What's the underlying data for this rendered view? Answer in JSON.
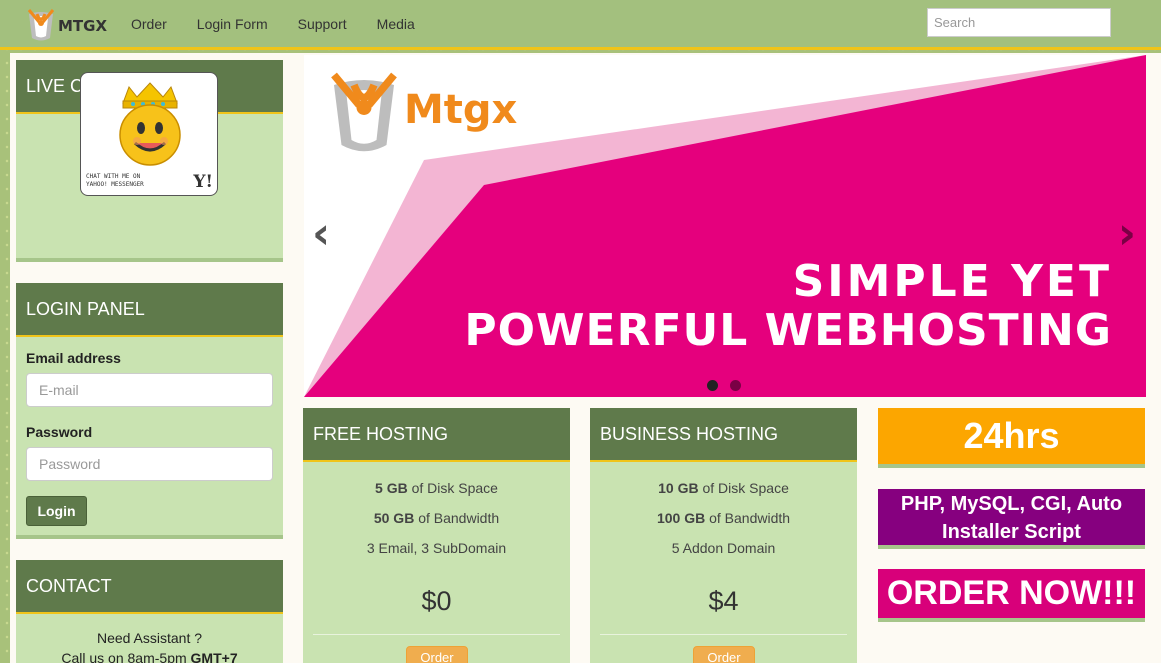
{
  "nav": {
    "brand": "MTGX",
    "links": [
      "Order",
      "Login Form",
      "Support",
      "Media"
    ],
    "search_placeholder": "Search"
  },
  "live_chat": {
    "title": "LIVE CHAT",
    "caption_line1": "CHAT WITH ME ON",
    "caption_line2": "YAHOO! MESSENGER",
    "yahoo_mark": "Y!"
  },
  "login_panel": {
    "title": "LOGIN PANEL",
    "email_label": "Email address",
    "email_placeholder": "E-mail",
    "password_label": "Password",
    "password_placeholder": "Password",
    "login_button": "Login"
  },
  "contact": {
    "title": "CONTACT",
    "line1": "Need Assistant ?",
    "line2_prefix": "Call us on 8am-5pm ",
    "line2_bold": "GMT+7"
  },
  "slider": {
    "logo_text": "Mtgx",
    "headline1": "SIMPLE YET",
    "headline2": "POWERFUL WEBHOSTING",
    "prev_arrow": "‹",
    "next_arrow": "›",
    "active_slide": 1,
    "slide_count": 2,
    "colors": {
      "magenta": "#e5007d",
      "pink": "#f3b5d3"
    }
  },
  "plans": [
    {
      "title": "FREE HOSTING",
      "features": [
        {
          "bold": "5 GB",
          "text": " of Disk Space"
        },
        {
          "bold": "50 GB",
          "text": " of Bandwidth"
        },
        {
          "bold": "",
          "text": "3 Email, 3 SubDomain"
        }
      ],
      "price": "$0",
      "order_label": "Order"
    },
    {
      "title": "BUSINESS HOSTING",
      "features": [
        {
          "bold": "10 GB",
          "text": " of Disk Space"
        },
        {
          "bold": "100 GB",
          "text": " of Bandwidth"
        },
        {
          "bold": "",
          "text": "5 Addon Domain"
        }
      ],
      "price": "$4",
      "order_label": "Order"
    }
  ],
  "banners": {
    "support": "24hrs",
    "features": "PHP, MySQL, CGI, Auto Installer Script",
    "order": "ORDER NOW!!!",
    "colors": {
      "orange": "#fca600",
      "purple": "#86007f",
      "magenta": "#d8007a"
    }
  }
}
